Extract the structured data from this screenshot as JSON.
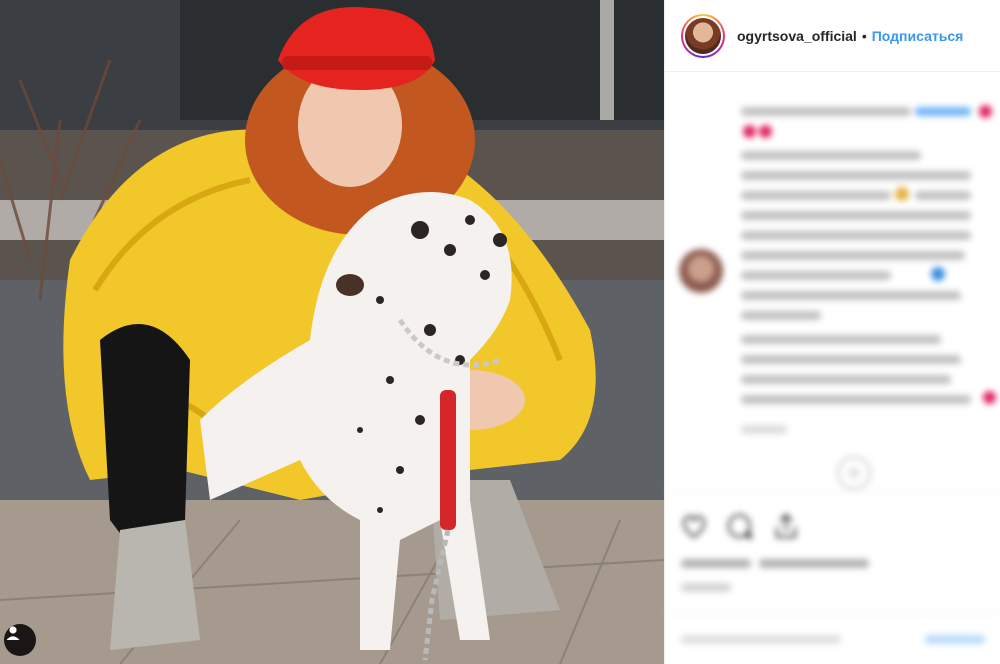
{
  "post": {
    "username": "ogyrtsova_official",
    "separator": "•",
    "follow_label": "Подписаться"
  },
  "icons": {
    "tag": "person-tag-icon",
    "like": "heart-icon",
    "comment": "comment-icon",
    "share": "share-icon",
    "load_more": "plus-circle-icon"
  },
  "colors": {
    "accent": "#3897f0",
    "heart": "#e0245e",
    "text": "#262626"
  }
}
